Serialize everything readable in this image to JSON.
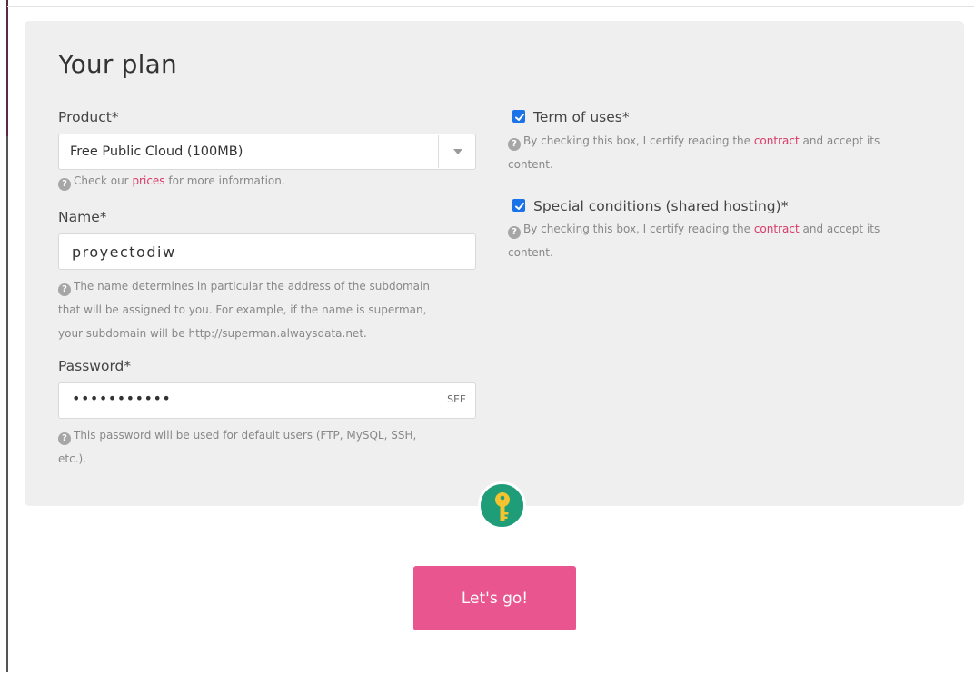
{
  "form": {
    "title": "Your plan",
    "product": {
      "label": "Product*",
      "selected": "Free Public Cloud (100MB)",
      "help_prefix": "Check our ",
      "help_link": "prices",
      "help_suffix": " for more information."
    },
    "name": {
      "label": "Name*",
      "value": "proyectodiw",
      "help_line1": "The name determines in particular the address of the subdomain",
      "help_line2": "that will be assigned to you. For example, if the name is superman,",
      "help_line3": "your subdomain will be http://superman.alwaysdata.net."
    },
    "password": {
      "label": "Password*",
      "value": "•••••••••••",
      "see_label": "SEE",
      "help_line1": "This password will be used for default users (FTP, MySQL, SSH,",
      "help_line2": "etc.)."
    },
    "terms": {
      "label": "Term of uses*",
      "checked": true,
      "help_prefix": "By checking this box, I certify reading the ",
      "help_link": "contract",
      "help_suffix": " and accept its",
      "help_line2": "content."
    },
    "special": {
      "label": "Special conditions (shared hosting)*",
      "checked": true,
      "help_prefix": "By checking this box, I certify reading the ",
      "help_link": "contract",
      "help_suffix": " and accept its",
      "help_line2": "content."
    },
    "submit_label": "Let's go!"
  },
  "icons": {
    "help": "question-circle-icon",
    "key": "key-icon",
    "caret": "chevron-down-icon",
    "check": "checkmark-icon"
  },
  "colors": {
    "accent": "#e9558f",
    "link": "#d63a6b",
    "checkbox": "#1a73e8",
    "key_badge": "#1f9c78",
    "key_color": "#f4c430"
  }
}
